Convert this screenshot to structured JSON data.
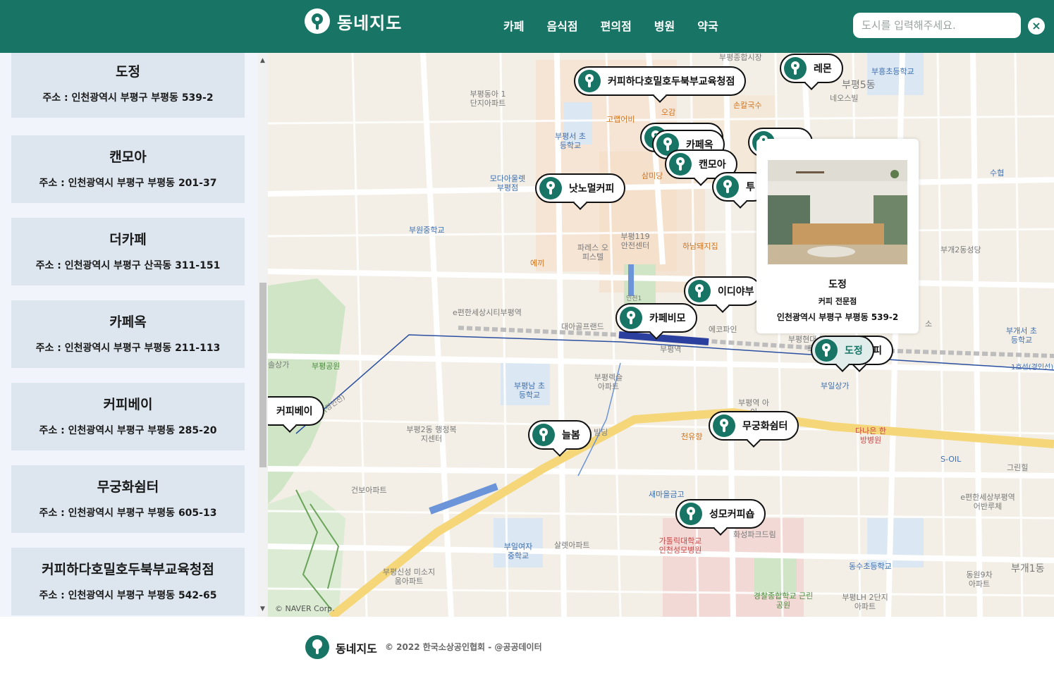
{
  "header": {
    "logo_text": "동네지도",
    "nav": [
      "카페",
      "음식점",
      "편의점",
      "병원",
      "약국"
    ],
    "search_placeholder": "도시를 입력해주세요.",
    "close_label": "×"
  },
  "sidebar": {
    "items": [
      {
        "name": "도정",
        "address": "주소 : 인천광역시 부평구 부평동 539-2"
      },
      {
        "name": "캔모아",
        "address": "주소 : 인천광역시 부평구 부평동 201-37"
      },
      {
        "name": "더카페",
        "address": "주소 : 인천광역시 부평구 산곡동 311-151"
      },
      {
        "name": "카페옥",
        "address": "주소 : 인천광역시 부평구 부평동 211-113"
      },
      {
        "name": "커피베이",
        "address": "주소 : 인천광역시 부평구 부평동 285-20"
      },
      {
        "name": "무궁화쉼터",
        "address": "주소 : 인천광역시 부평구 부평동 605-13"
      },
      {
        "name": "커피하다호밀호두북부교육청점",
        "address": "주소 : 인천광역시 부평구 부평동 542-65"
      }
    ]
  },
  "map": {
    "markers": [
      "커피하다호밀호두북부교육청점",
      "레몬",
      "카페옥",
      "캔모아",
      "낫노멀커피",
      "투",
      "이디야부",
      "카페비모",
      "도정",
      "피",
      "커피베이",
      "늘봄",
      "무궁화쉼터",
      "성모커피숍"
    ],
    "places": [
      "부평종합시장",
      "부평동아 1단지아파트",
      "부평5동",
      "네오스빌",
      "부흥초등학교",
      "오감",
      "손칼국수",
      "고랩어비",
      "부평서 초등학교",
      "삼미당",
      "모다아울렛 부평점",
      "수협",
      "부원중학교",
      "부평119 안전센터",
      "파레스 오피스텔",
      "하남돼지집",
      "에끼",
      "부개2동성당",
      "인천1",
      "e편한세상시티부평역",
      "대아골프랜드",
      "에코파인",
      "부평역",
      "부평현대 더우르",
      "부개서 초등학교",
      "1호선(경인선)",
      "부평공원",
      "솔상가",
      "부평남 초등학교",
      "부평렉슬 아파트",
      "부일상가",
      "부평역 아이",
      "선(경인선)",
      "부평2동 행정복지센터",
      "빌딩",
      "천유향",
      "다나은 한방병원",
      "S-OIL",
      "그린힐",
      "건보아파트",
      "새마을금고",
      "e편한세상부평역 어반루체",
      "부일여자 중학교",
      "살렛아파트",
      "가톨릭대학교 인천성모병원",
      "화성파크드림",
      "부평신성 미소지움아파트",
      "동수초등학교",
      "부평LH 2단지아파트",
      "동원9차 아파트",
      "부개1동",
      "경찰종합학교 근린공원",
      "소"
    ],
    "copyright": "© NAVER Corp."
  },
  "popup": {
    "name": "도정",
    "category": "커피 전문점",
    "address": "인천광역시 부평구 부평동 539-2"
  },
  "footer": {
    "title": "동네지도",
    "copyright": "© 2022 한국소상공인협회 - @공공데이터"
  },
  "colors": {
    "brand": "#187565",
    "card": "#dde6ef",
    "sidebar_bg": "#f1f4fa"
  }
}
